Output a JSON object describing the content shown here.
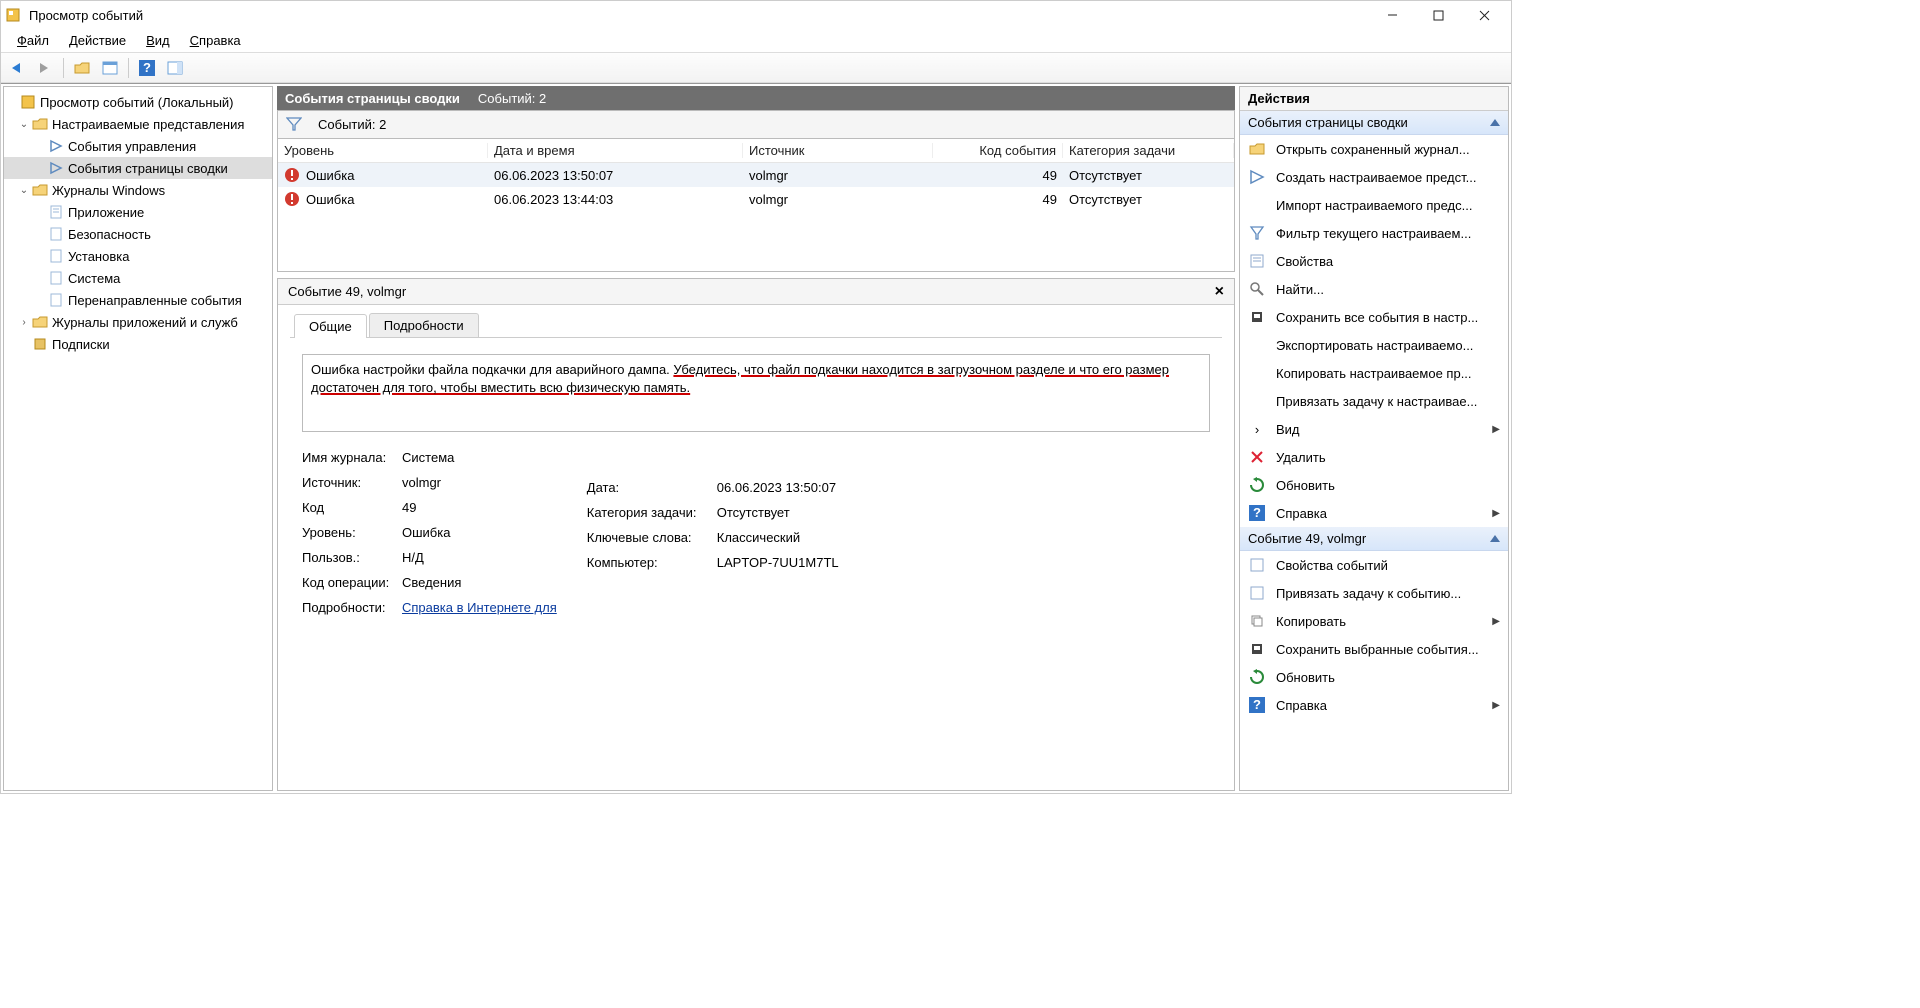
{
  "window": {
    "title": "Просмотр событий"
  },
  "menu": {
    "file": "Файл",
    "action": "Действие",
    "view": "Вид",
    "help": "Справка"
  },
  "tree": {
    "root": "Просмотр событий (Локальный)",
    "custom": "Настраиваемые представления",
    "admin": "События управления",
    "summary": "События страницы сводки",
    "winlogs": "Журналы Windows",
    "app": "Приложение",
    "security": "Безопасность",
    "setup": "Установка",
    "system": "Система",
    "forward": "Перенаправленные события",
    "appsvc": "Журналы приложений и служб",
    "subs": "Подписки"
  },
  "header": {
    "title": "События страницы сводки",
    "count": "Событий: 2"
  },
  "filter": {
    "count": "Событий: 2"
  },
  "columns": {
    "level": "Уровень",
    "dt": "Дата и время",
    "src": "Источник",
    "code": "Код события",
    "cat": "Категория задачи"
  },
  "rows": [
    {
      "level": "Ошибка",
      "dt": "06.06.2023 13:50:07",
      "src": "volmgr",
      "code": "49",
      "cat": "Отсутствует"
    },
    {
      "level": "Ошибка",
      "dt": "06.06.2023 13:44:03",
      "src": "volmgr",
      "code": "49",
      "cat": "Отсутствует"
    }
  ],
  "detail": {
    "title": "Событие 49, volmgr",
    "tab_general": "Общие",
    "tab_details": "Подробности",
    "msg_plain": "Ошибка настройки файла подкачки для аварийного дампа. ",
    "msg_red": "Убедитесь, что файл подкачки находится в загрузочном разделе и что его размер достаточен для того, чтобы вместить всю физическую память.",
    "labels": {
      "logname": "Имя журнала:",
      "source": "Источник:",
      "code": "Код",
      "level": "Уровень:",
      "user": "Пользов.:",
      "opcode": "Код операции:",
      "moreinfo": "Подробности:",
      "date": "Дата:",
      "taskcat": "Категория задачи:",
      "keywords": "Ключевые слова:",
      "computer": "Компьютер:"
    },
    "values": {
      "logname": "Система",
      "source": "volmgr",
      "code": "49",
      "level": "Ошибка",
      "user": "Н/Д",
      "opcode": "Сведения",
      "date": "06.06.2023 13:50:07",
      "taskcat": "Отсутствует",
      "keywords": "Классический",
      "computer": "LAPTOP-7UU1M7TL",
      "helplink": "Справка в Интернете для "
    }
  },
  "actions": {
    "title": "Действия",
    "group1": "События страницы сводки",
    "items1": [
      "Открыть сохраненный журнал...",
      "Создать настраиваемое предст...",
      "Импорт настраиваемого предс...",
      "Фильтр текущего настраиваем...",
      "Свойства",
      "Найти...",
      "Сохранить все события в настр...",
      "Экспортировать настраиваемо...",
      "Копировать настраиваемое пр...",
      "Привязать задачу к настраивае...",
      "Вид",
      "Удалить",
      "Обновить",
      "Справка"
    ],
    "group2": "Событие 49, volmgr",
    "items2": [
      "Свойства событий",
      "Привязать задачу к событию...",
      "Копировать",
      "Сохранить выбранные события...",
      "Обновить",
      "Справка"
    ]
  }
}
